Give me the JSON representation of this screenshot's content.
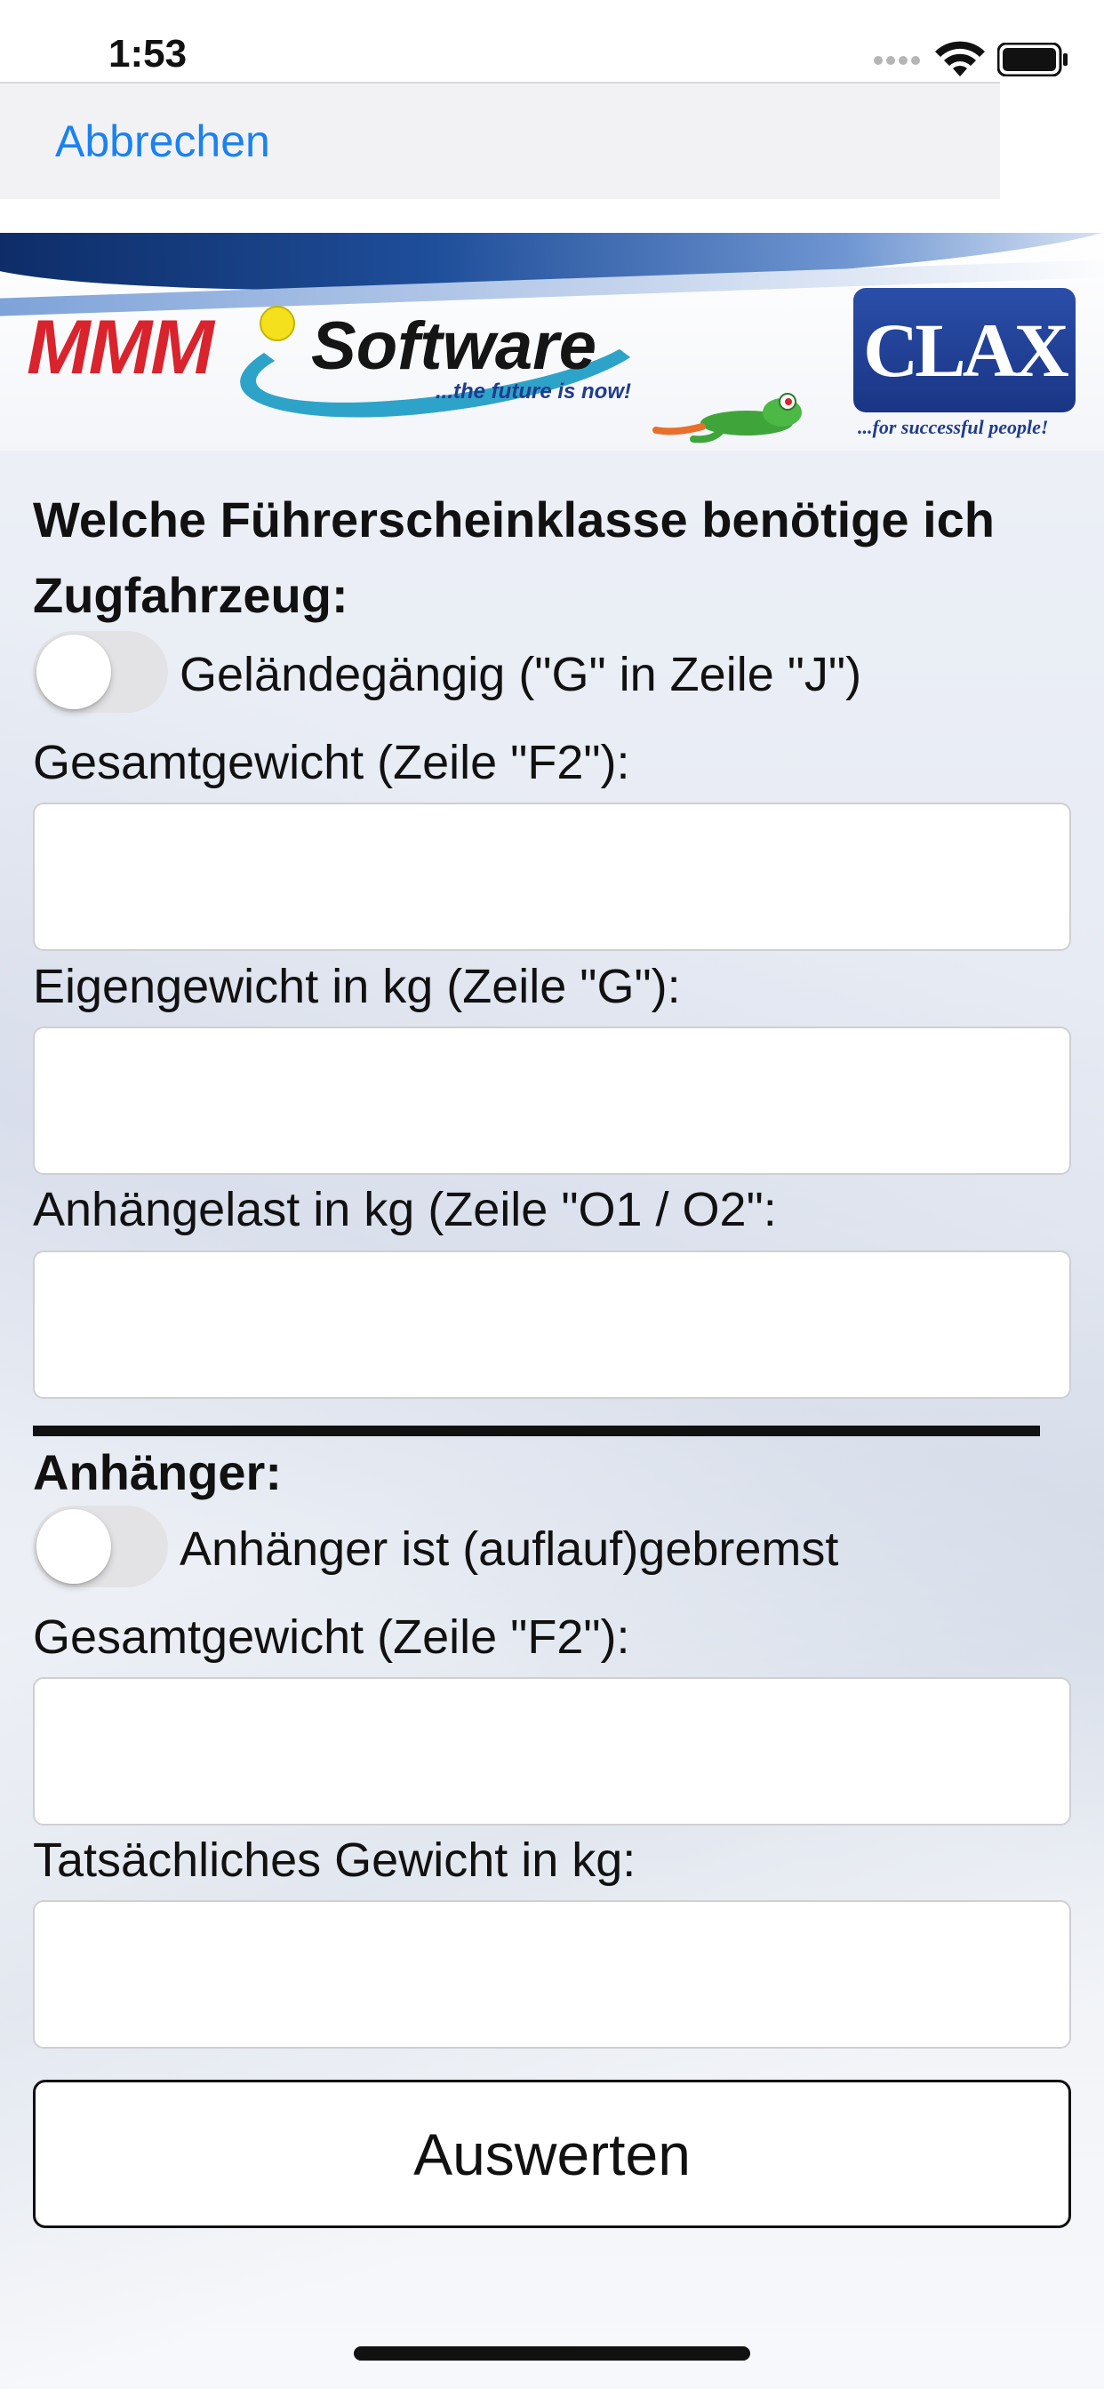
{
  "status_bar": {
    "time": "1:53",
    "icons": [
      "signal-dots-icon",
      "wifi-icon",
      "battery-icon"
    ]
  },
  "nav": {
    "cancel_label": "Abbrechen"
  },
  "banner": {
    "brand_left": "MMM",
    "brand_software": "Software",
    "brand_tagline": "...the future is now!",
    "brand_right": "CLAX",
    "brand_right_tagline": "...for successful people!"
  },
  "form": {
    "title": "Welche Führerscheinklasse benötige ich",
    "towing_vehicle": {
      "heading": "Zugfahrzeug:",
      "offroad_toggle_label": "Geländegängig (\"G\" in Zeile \"J\")",
      "offroad_on": false,
      "total_weight_label": "Gesamtgewicht (Zeile \"F2\"):",
      "total_weight_value": "",
      "curb_weight_label": "Eigengewicht in kg (Zeile \"G\"):",
      "curb_weight_value": "",
      "towing_capacity_label": "Anhängelast in kg (Zeile \"O1 / O2\":",
      "towing_capacity_value": ""
    },
    "trailer": {
      "heading": "Anhänger:",
      "braked_toggle_label": "Anhänger ist (auflauf)gebremst",
      "braked_on": false,
      "total_weight_label": "Gesamtgewicht (Zeile \"F2\"):",
      "total_weight_value": "",
      "actual_weight_label": "Tatsächliches Gewicht in kg:",
      "actual_weight_value": ""
    },
    "submit_label": "Auswerten"
  },
  "colors": {
    "accent_link": "#1a82f0",
    "mmm_red": "#d9232d",
    "clax_blue": "#1f3c8c"
  }
}
